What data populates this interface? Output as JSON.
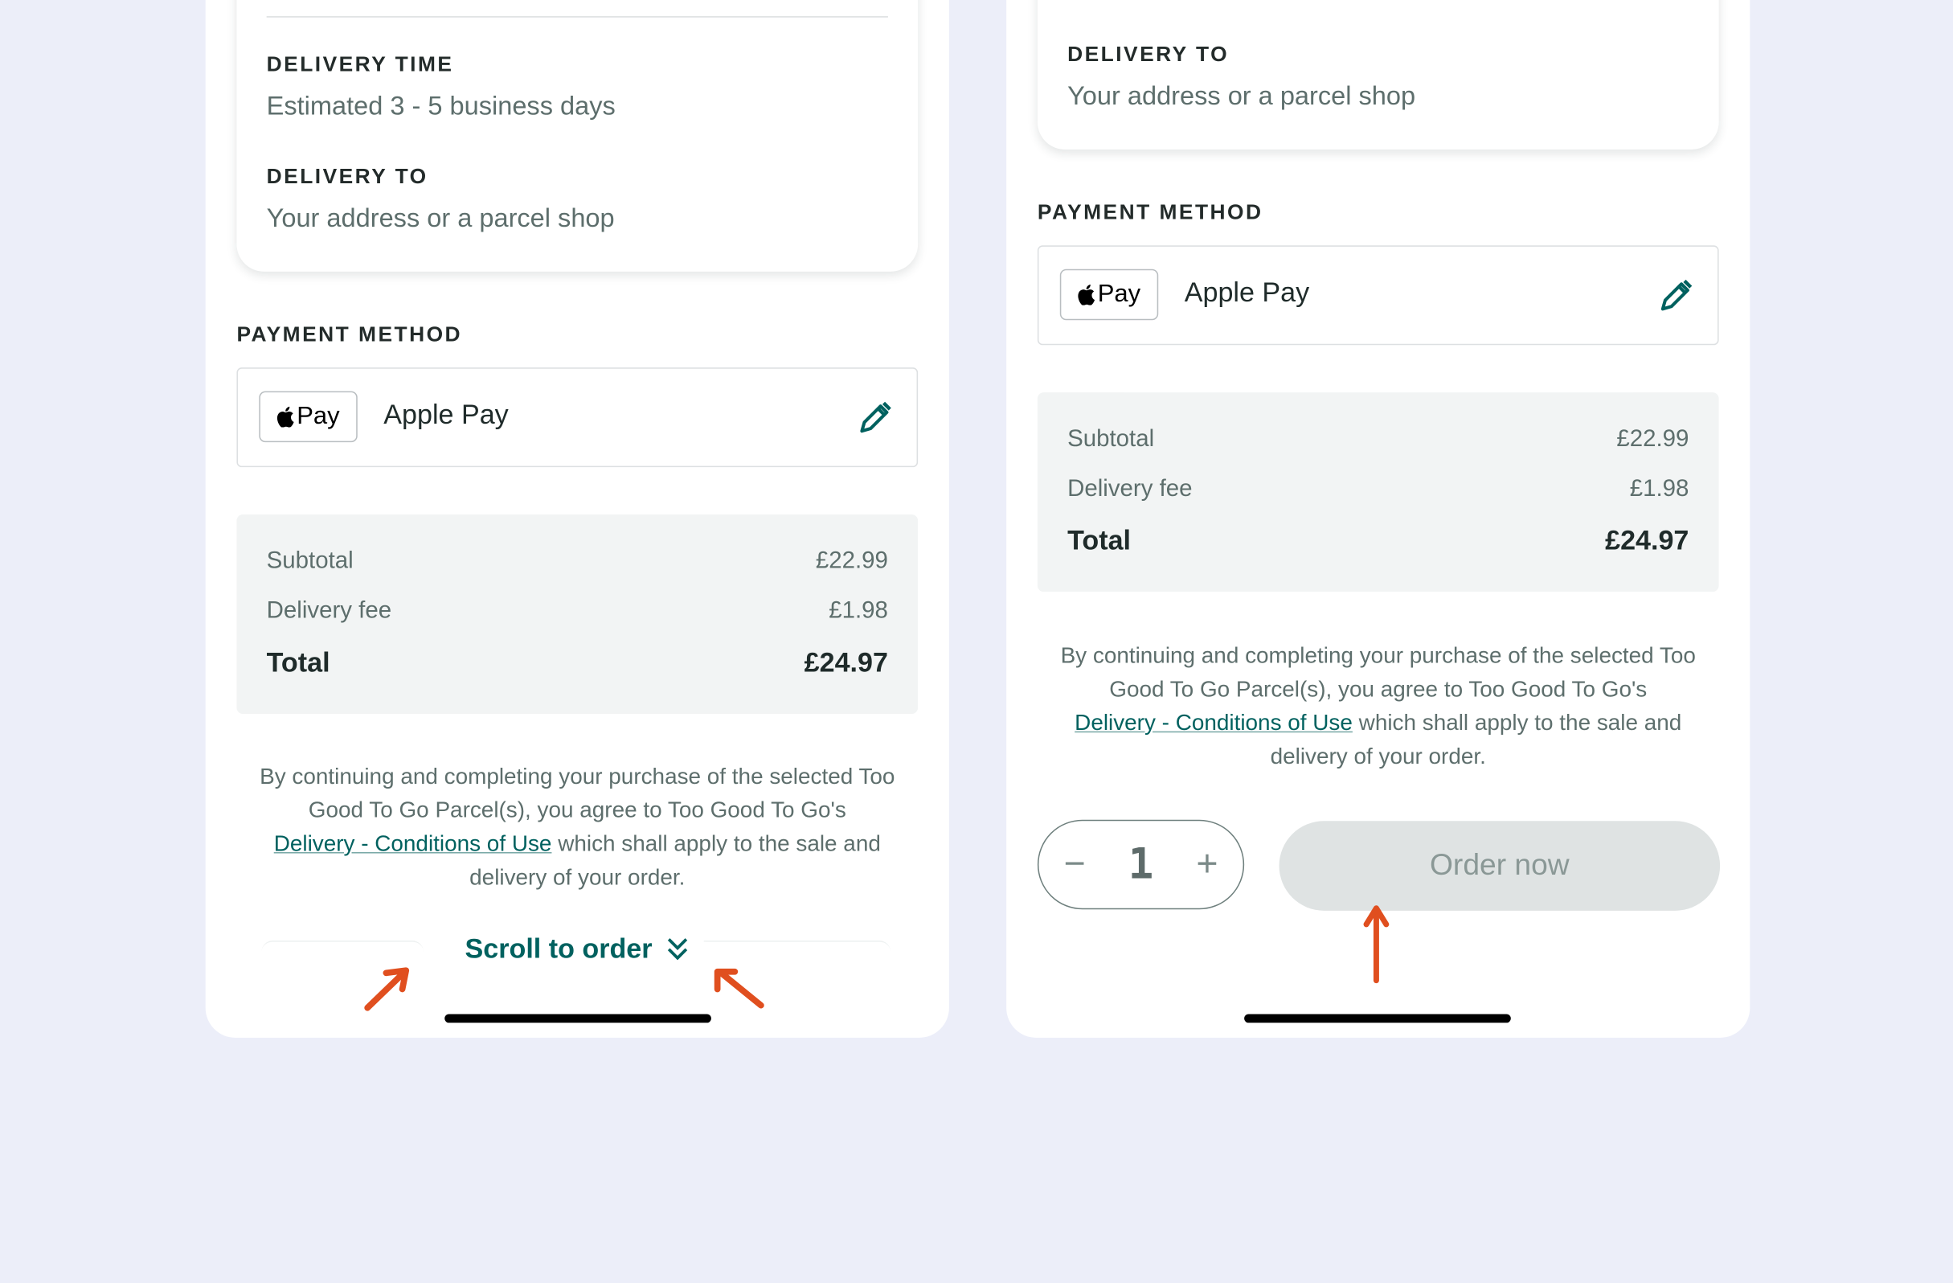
{
  "left_screen": {
    "delivery_time_label": "DELIVERY TIME",
    "delivery_time_value": "Estimated 3 - 5 business days",
    "delivery_to_label": "DELIVERY TO",
    "delivery_to_value": "Your address or a parcel shop",
    "payment_method_title": "PAYMENT METHOD",
    "payment_badge_text": "Pay",
    "payment_name": "Apple Pay",
    "summary": [
      {
        "label": "Subtotal",
        "value": "£22.99"
      },
      {
        "label": "Delivery fee",
        "value": "£1.98"
      },
      {
        "label": "Total",
        "value": "£24.97"
      }
    ],
    "terms_before": "By continuing and completing your purchase of the selected Too Good To Go Parcel(s), you agree to Too Good To Go's",
    "terms_link": "Delivery - Conditions of Use",
    "terms_after": "which shall apply to the sale and delivery of your order.",
    "scroll_button": "Scroll to order"
  },
  "right_screen": {
    "delivery_to_label": "DELIVERY TO",
    "delivery_to_value": "Your address or a parcel shop",
    "payment_method_title": "PAYMENT METHOD",
    "payment_badge_text": "Pay",
    "payment_name": "Apple Pay",
    "summary": [
      {
        "label": "Subtotal",
        "value": "£22.99"
      },
      {
        "label": "Delivery fee",
        "value": "£1.98"
      },
      {
        "label": "Total",
        "value": "£24.97"
      }
    ],
    "terms_before": "By continuing and completing your purchase of the selected Too Good To Go Parcel(s), you agree to Too Good To Go's",
    "terms_link": "Delivery - Conditions of Use",
    "terms_after": "which shall apply to the sale and delivery of your order.",
    "stepper": {
      "decrement": "−",
      "quantity": "1",
      "increment": "+"
    },
    "order_button": "Order now"
  },
  "colors": {
    "brand_teal": "#00615f",
    "annotation_arrow": "#e04f1f",
    "background": "#eceef9",
    "disabled_button": "#dfe3e3"
  }
}
